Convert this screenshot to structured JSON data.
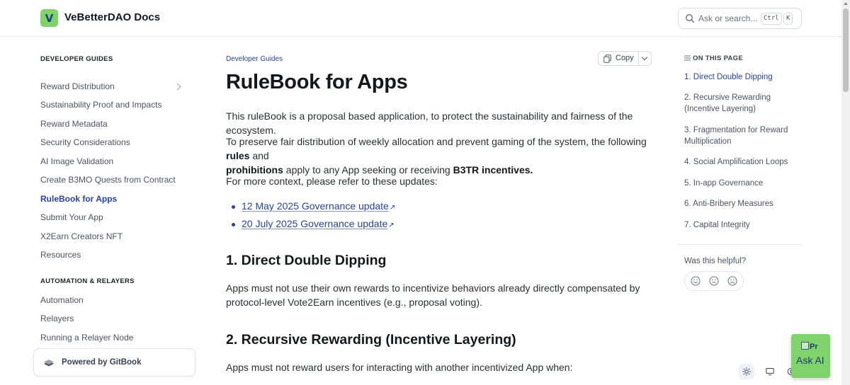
{
  "header": {
    "logo_text": "V",
    "site_title": "VeBetterDAO Docs",
    "search_placeholder": "Ask or search...",
    "kbd_ctrl": "Ctrl",
    "kbd_k": "K"
  },
  "sidebar": {
    "section1_heading": "DEVELOPER GUIDES",
    "items1": [
      {
        "label": "Reward Distribution"
      },
      {
        "label": "Sustainability Proof and Impacts"
      },
      {
        "label": "Reward Metadata"
      },
      {
        "label": "Security Considerations"
      },
      {
        "label": "AI Image Validation"
      },
      {
        "label": "Create B3MO Quests from Contract"
      },
      {
        "label": "RuleBook for Apps"
      },
      {
        "label": "Submit Your App"
      },
      {
        "label": "X2Earn Creators NFT"
      },
      {
        "label": "Resources"
      }
    ],
    "section2_heading": "AUTOMATION & RELAYERS",
    "items2": [
      {
        "label": "Automation"
      },
      {
        "label": "Relayers"
      },
      {
        "label": "Running a Relayer Node"
      }
    ],
    "powered_by": "Powered by GitBook"
  },
  "main": {
    "breadcrumb": "Developer Guides",
    "copy_label": "Copy",
    "title": "RuleBook for Apps",
    "intro": "This ruleBook is a proposal based application, to protect the sustainability and fairness of the ecosystem.",
    "p2_part1": "To preserve fair distribution of weekly allocation and prevent gaming of the system, the following ",
    "p2_rules": "rules",
    "p2_and": " and",
    "p2_prohibitions": "prohibitions",
    "p2_part2": " apply to any App seeking or receiving ",
    "p2_b3tr": "B3TR incentives.",
    "p3": "For more context, please refer to these updates:",
    "links": [
      {
        "label": "12 May 2025 Governance update"
      },
      {
        "label": "20 July 2025 Governance update"
      }
    ],
    "ext_arrow": "↗",
    "h2_1": "1. Direct Double Dipping",
    "p4": "Apps must not use their own rewards to incentivize behaviors already directly compensated by protocol-level Vote2Earn incentives (e.g., proposal voting).",
    "h2_2": "2. Recursive Rewarding (Incentive Layering)",
    "p5": "Apps must not reward users for interacting with another incentivized App when:"
  },
  "toc": {
    "heading": "ON THIS PAGE",
    "items": [
      {
        "label": "1. Direct Double Dipping"
      },
      {
        "label": "2. Recursive Rewarding (Incentive Layering)"
      },
      {
        "label": "3. Fragmentation for Reward Multiplication"
      },
      {
        "label": "4. Social Amplification Loops"
      },
      {
        "label": "5. In-app Governance"
      },
      {
        "label": "6. Anti-Bribery Measures"
      },
      {
        "label": "7. Capital Integrity"
      }
    ],
    "helpful_question": "Was this helpful?"
  },
  "ask_ai": {
    "img_alt": "Pr",
    "label": "Ask AI"
  },
  "colors": {
    "accent": "#2541b2",
    "brand_green": "#7fd36a"
  },
  "icons": [
    "search-icon",
    "chevron-right-icon",
    "gitbook-icon",
    "copy-icon",
    "chevron-down-icon",
    "list-icon",
    "smile-face-icon",
    "neutral-face-icon",
    "sad-face-icon",
    "sun-icon",
    "monitor-icon",
    "moon-icon",
    "external-link-icon"
  ]
}
